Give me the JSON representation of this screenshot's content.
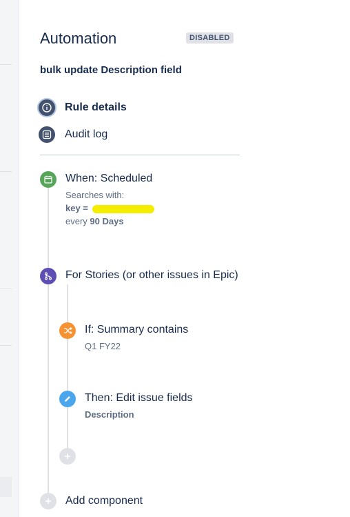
{
  "header": {
    "title": "Automation",
    "status_badge": "DISABLED",
    "rule_name": "bulk update Description field"
  },
  "nav": {
    "items": [
      {
        "label": "Rule details",
        "icon": "info-icon",
        "active": true
      },
      {
        "label": "Audit log",
        "icon": "list-icon",
        "active": false
      }
    ]
  },
  "components": {
    "trigger": {
      "title": "When: Scheduled",
      "searches_label": "Searches with:",
      "key_label": "key =",
      "every_label": "every",
      "interval": "90 Days",
      "icon": "calendar-icon",
      "color": "#57a55a"
    },
    "branch": {
      "title": "For Stories (or other issues in Epic)",
      "icon": "branch-icon",
      "color": "#5e4db2"
    },
    "condition": {
      "title": "If: Summary contains",
      "value": "Q1 FY22",
      "icon": "shuffle-icon",
      "color": "#f79233"
    },
    "action": {
      "title": "Then: Edit issue fields",
      "value": "Description",
      "icon": "pencil-icon",
      "color": "#4ba6ee"
    },
    "add_component_label": "Add component"
  }
}
